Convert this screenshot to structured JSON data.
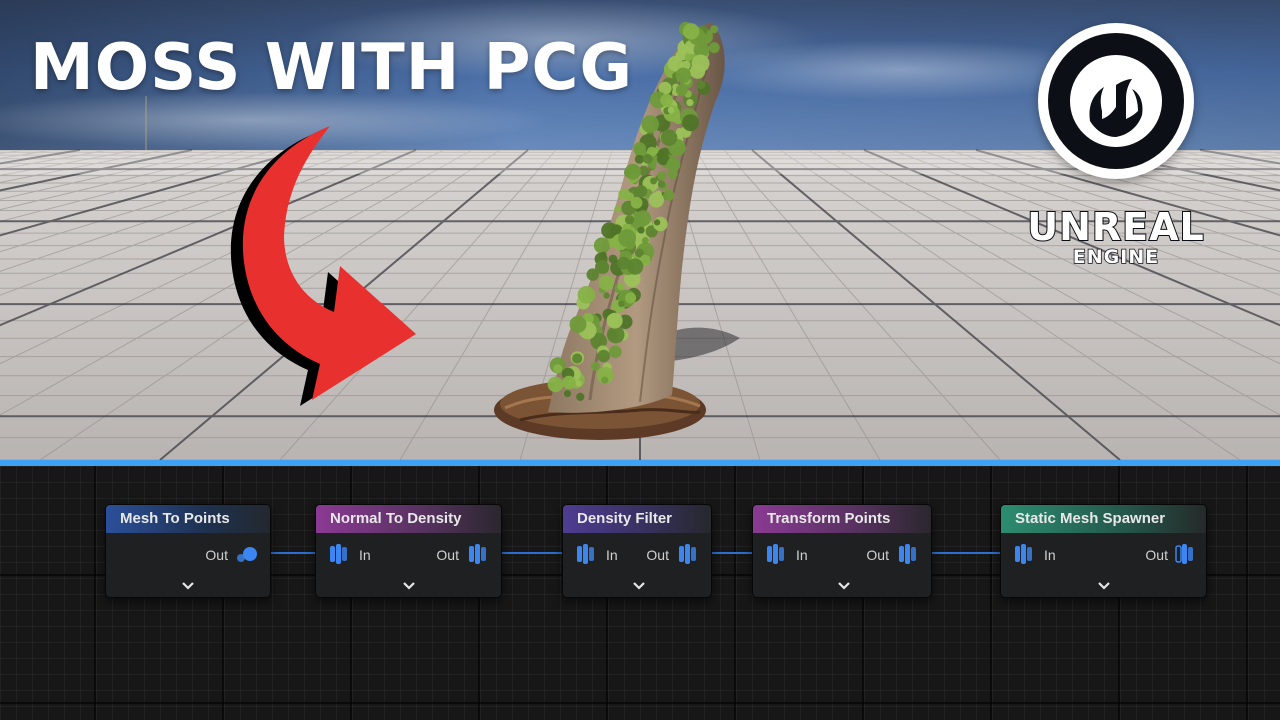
{
  "title": "MOSS WITH PCG",
  "logo": {
    "word_1": "UNREAL",
    "word_2": "ENGINE"
  },
  "nodes": [
    {
      "title": "Mesh To Points",
      "pins_out": "Out"
    },
    {
      "title": "Normal To Density",
      "pin_in": "In",
      "pins_out": "Out"
    },
    {
      "title": "Density Filter",
      "pin_in": "In",
      "pins_out": "Out"
    },
    {
      "title": "Transform Points",
      "pin_in": "In",
      "pins_out": "Out"
    },
    {
      "title": "Static Mesh Spawner",
      "pin_in": "In",
      "pins_out": "Out"
    }
  ],
  "colors": {
    "divider": "#3ea1f3",
    "pin": "#3b86f0",
    "arrow": "#e8312f",
    "wire": "#2d6fcf"
  },
  "icons": [
    "arrow-icon",
    "unreal-engine-logo",
    "point-pin-icon",
    "stack-pin-icon",
    "chevron-down-icon"
  ]
}
